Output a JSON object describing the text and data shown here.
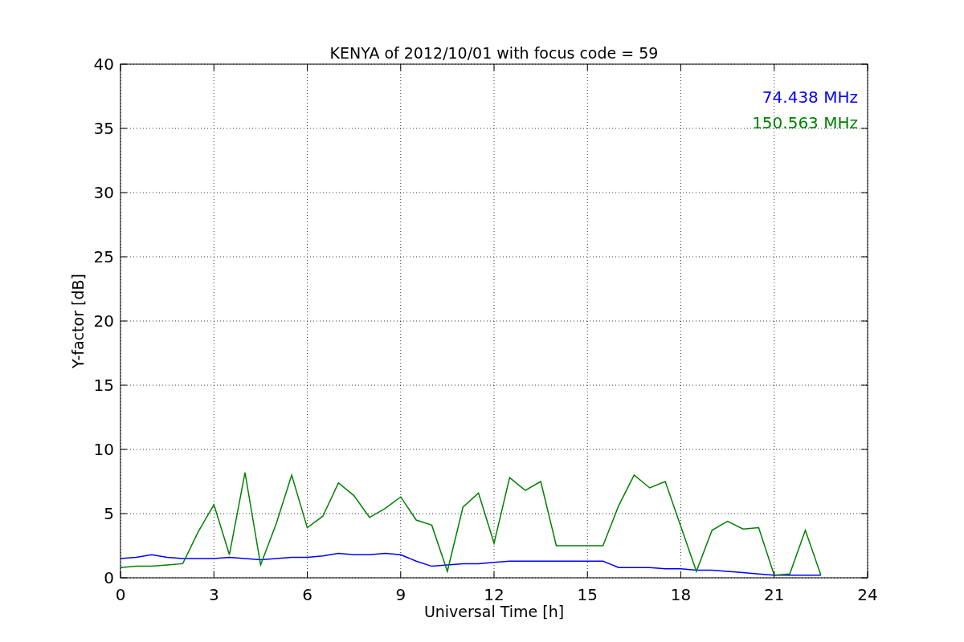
{
  "chart_data": {
    "type": "line",
    "title": "KENYA of 2012/10/01 with focus code = 59",
    "xlabel": "Universal Time [h]",
    "ylabel": "Y-factor [dB]",
    "grid": true,
    "xlim": [
      0,
      24
    ],
    "ylim": [
      0,
      40
    ],
    "xticks": [
      0,
      3,
      6,
      9,
      12,
      15,
      18,
      21,
      24
    ],
    "yticks": [
      0,
      5,
      10,
      15,
      20,
      25,
      30,
      35,
      40
    ],
    "x": [
      0,
      0.5,
      1,
      1.5,
      2,
      2.5,
      3,
      3.5,
      4,
      4.5,
      5,
      5.5,
      6,
      6.5,
      7,
      7.5,
      8,
      8.5,
      9,
      9.5,
      10,
      10.5,
      11,
      11.5,
      12,
      12.5,
      13,
      13.5,
      14,
      14.5,
      15,
      15.5,
      16,
      16.5,
      17,
      17.5,
      18,
      18.5,
      19,
      19.5,
      20,
      20.5,
      21,
      21.5,
      22,
      22.5
    ],
    "series": [
      {
        "name": "74.438 MHz",
        "color": "#0000ff",
        "values": [
          1.5,
          1.6,
          1.8,
          1.6,
          1.5,
          1.5,
          1.5,
          1.6,
          1.5,
          1.4,
          1.5,
          1.6,
          1.6,
          1.7,
          1.9,
          1.8,
          1.8,
          1.9,
          1.8,
          1.3,
          0.9,
          1.0,
          1.1,
          1.1,
          1.2,
          1.3,
          1.3,
          1.3,
          1.3,
          1.3,
          1.3,
          1.3,
          0.8,
          0.8,
          0.8,
          0.7,
          0.7,
          0.6,
          0.6,
          0.5,
          0.4,
          0.3,
          0.2,
          0.2,
          0.2,
          0.2
        ]
      },
      {
        "name": "150.563 MHz",
        "color": "#008000",
        "values": [
          0.8,
          0.9,
          0.9,
          1.0,
          1.1,
          3.6,
          5.7,
          1.8,
          8.2,
          1.0,
          4.2,
          8.0,
          3.9,
          4.8,
          7.4,
          6.4,
          4.7,
          5.4,
          6.3,
          4.5,
          4.1,
          0.5,
          5.5,
          6.6,
          2.7,
          7.8,
          6.8,
          7.5,
          2.5,
          2.5,
          2.5,
          2.5,
          5.6,
          8.0,
          7.0,
          7.5,
          4.0,
          0.5,
          3.7,
          4.4,
          3.8,
          3.9,
          0.2,
          0.3,
          3.7,
          0.2
        ]
      }
    ]
  }
}
